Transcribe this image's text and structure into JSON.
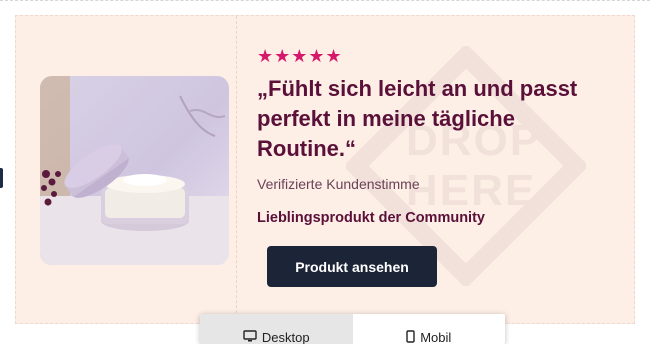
{
  "review": {
    "stars": "★★★★★",
    "quote": "„Fühlt sich leicht an und passt perfekt in meine tägliche Routine.“",
    "attribution": "Verifizierte Kundenstimme",
    "tagline": "Lieblingsprodukt der Community",
    "cta_label": "Produkt ansehen"
  },
  "watermark": {
    "line1": "DROP",
    "line2": "HERE"
  },
  "device_switcher": {
    "tabs": [
      {
        "label": "Desktop",
        "icon": "monitor-icon",
        "active": true
      },
      {
        "label": "Mobil",
        "icon": "phone-icon",
        "active": false
      }
    ]
  },
  "colors": {
    "card_bg": "#fdeee6",
    "accent_pink": "#d6186a",
    "heading_plum": "#5a1038",
    "button_navy": "#1c2438"
  }
}
